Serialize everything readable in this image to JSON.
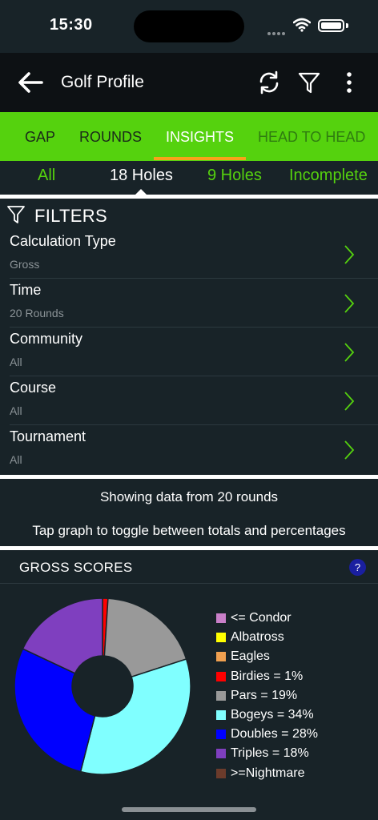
{
  "status": {
    "time": "15:30"
  },
  "app_bar": {
    "title": "Golf Profile"
  },
  "main_tabs": [
    {
      "label": "GAP"
    },
    {
      "label": "ROUNDS"
    },
    {
      "label": "INSIGHTS"
    },
    {
      "label": "HEAD TO HEAD"
    }
  ],
  "sub_tabs": [
    {
      "label": "All"
    },
    {
      "label": "18 Holes"
    },
    {
      "label": "9 Holes"
    },
    {
      "label": "Incomplete"
    }
  ],
  "filters": {
    "title": "FILTERS",
    "rows": [
      {
        "label": "Calculation Type",
        "value": "Gross"
      },
      {
        "label": "Time",
        "value": "20 Rounds"
      },
      {
        "label": "Community",
        "value": "All"
      },
      {
        "label": "Course",
        "value": "All"
      },
      {
        "label": "Tournament",
        "value": "All"
      }
    ]
  },
  "info": {
    "line1": "Showing data from 20 rounds",
    "line2": "Tap graph to toggle between totals and percentages"
  },
  "chart_header": {
    "title": "GROSS SCORES",
    "help": "?"
  },
  "chart_data": {
    "type": "pie",
    "title": "GROSS SCORES",
    "legend_position": "right",
    "series": [
      {
        "label": "<= Condor",
        "value": 0,
        "color": "#c97fc8"
      },
      {
        "label": "Albatross",
        "value": 0,
        "color": "#ffff00"
      },
      {
        "label": "Eagles",
        "value": 0,
        "color": "#f0a050"
      },
      {
        "label": "Birdies = 1%",
        "value": 1,
        "color": "#ff0000"
      },
      {
        "label": "Pars = 19%",
        "value": 19,
        "color": "#999999"
      },
      {
        "label": "Bogeys = 34%",
        "value": 34,
        "color": "#80ffff"
      },
      {
        "label": "Doubles = 28%",
        "value": 28,
        "color": "#0000ff"
      },
      {
        "label": "Triples = 18%",
        "value": 18,
        "color": "#7f3fbf"
      },
      {
        "label": ">=Nightmare",
        "value": 0,
        "color": "#6b3b2b"
      }
    ]
  }
}
